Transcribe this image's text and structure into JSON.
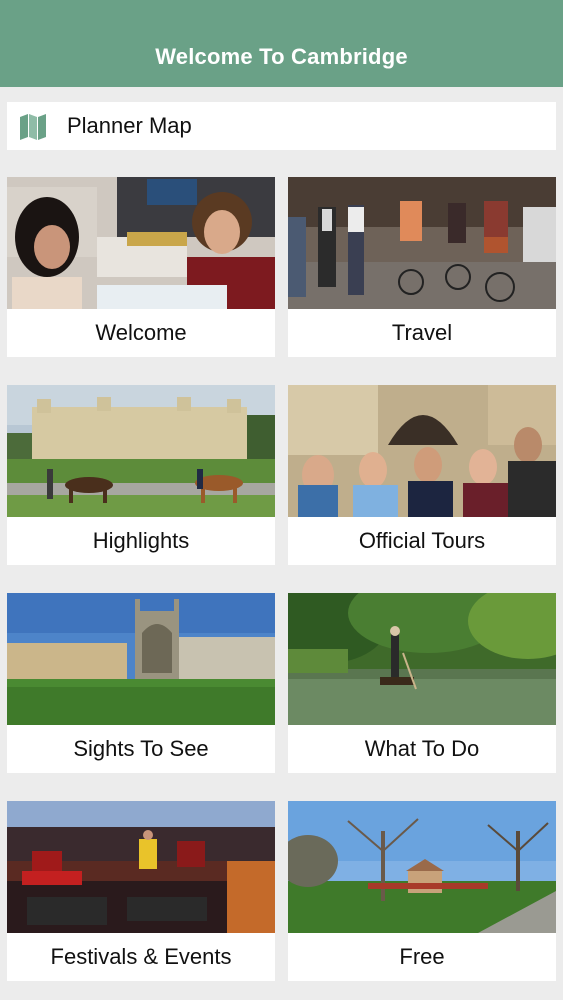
{
  "header": {
    "title": "Welcome To Cambridge"
  },
  "planner": {
    "label": "Planner Map",
    "icon": "map-icon"
  },
  "colors": {
    "header_bg": "#6aa187",
    "icon": "#6aa187",
    "page_bg": "#ececec"
  },
  "tiles": [
    {
      "label": "Welcome"
    },
    {
      "label": "Travel"
    },
    {
      "label": "Highlights"
    },
    {
      "label": "Official Tours"
    },
    {
      "label": "Sights To See"
    },
    {
      "label": "What To Do"
    },
    {
      "label": "Festivals & Events"
    },
    {
      "label": "Free"
    }
  ]
}
